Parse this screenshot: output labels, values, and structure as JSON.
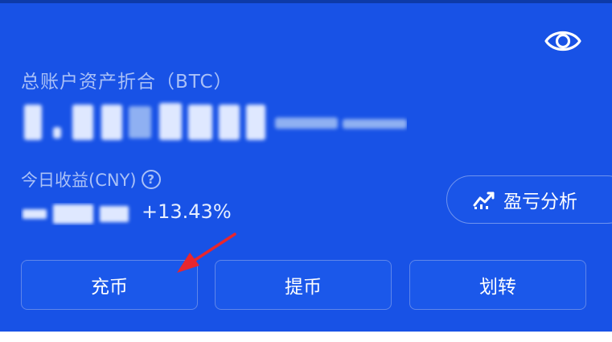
{
  "card": {
    "total_assets_label": "总账户资产折合（BTC）",
    "today_earnings_label": "今日收益(CNY)",
    "help_symbol": "?",
    "today_change_percent": "+13.43%",
    "pnl_button_label": "盈亏分析",
    "actions": {
      "deposit": "充币",
      "withdraw": "提币",
      "transfer": "划转"
    }
  },
  "icons": {
    "visibility": "eye-icon",
    "analysis": "chart-trend-icon",
    "help": "question-icon",
    "annotation": "red-arrow-annotation"
  },
  "colors": {
    "card_background": "#1852e6",
    "label_text": "#a9c0f7",
    "button_border": "#5f86ea",
    "annotation_arrow": "#e8262d"
  }
}
